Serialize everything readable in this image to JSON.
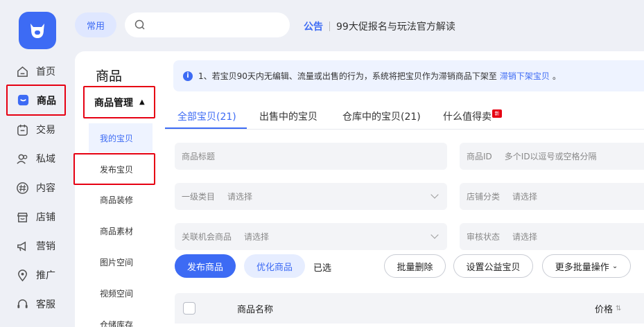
{
  "sidebar": {
    "logo_icon": "cow-logo-icon",
    "items": [
      {
        "label": "首页",
        "icon": "home-icon"
      },
      {
        "label": "商品",
        "icon": "goods-icon",
        "active": true
      },
      {
        "label": "交易",
        "icon": "trade-icon"
      },
      {
        "label": "私域",
        "icon": "users-icon"
      },
      {
        "label": "内容",
        "icon": "hash-icon"
      },
      {
        "label": "店铺",
        "icon": "shop-icon"
      },
      {
        "label": "营销",
        "icon": "megaphone-icon"
      },
      {
        "label": "推广",
        "icon": "location-icon"
      },
      {
        "label": "客服",
        "icon": "headset-icon"
      }
    ]
  },
  "topbar": {
    "common_label": "常用",
    "search_placeholder": "",
    "notice_label": "公告",
    "notice_text": "99大促报名与玩法官方解读"
  },
  "page": {
    "title": "商品",
    "subnav_header": "商品管理",
    "subnav_items": [
      "我的宝贝",
      "发布宝贝",
      "商品装修",
      "商品素材",
      "图片空间",
      "视频空间",
      "仓储库存"
    ]
  },
  "info": {
    "text": "1、若宝贝90天内无编辑、流量或出售的行为，系统将把宝贝作为滞销商品下架至",
    "link": "滞销下架宝贝",
    "tail": "。"
  },
  "tabs": [
    {
      "label": "全部宝贝(21)",
      "active": true
    },
    {
      "label": "出售中的宝贝"
    },
    {
      "label": "仓库中的宝贝(21)"
    },
    {
      "label": "什么值得卖",
      "badge": "新"
    }
  ],
  "filters": {
    "title_placeholder": "商品标题",
    "id_label": "商品ID",
    "id_placeholder": "多个ID以逗号或空格分隔",
    "category_label": "一级类目",
    "category_placeholder": "请选择",
    "shop_cat_label": "店铺分类",
    "shop_cat_placeholder": "请选择",
    "opportunity_label": "关联机会商品",
    "opportunity_placeholder": "请选择",
    "review_label": "审核状态",
    "review_placeholder": "请选择"
  },
  "actions": {
    "publish": "发布商品",
    "optimize": "优化商品",
    "selected": "已选",
    "batch_delete": "批量删除",
    "charity": "设置公益宝贝",
    "more_batch": "更多批量操作"
  },
  "table": {
    "col_name": "商品名称",
    "col_price": "价格"
  },
  "colors": {
    "accent": "#3d6bf4",
    "highlight": "#e60012"
  }
}
